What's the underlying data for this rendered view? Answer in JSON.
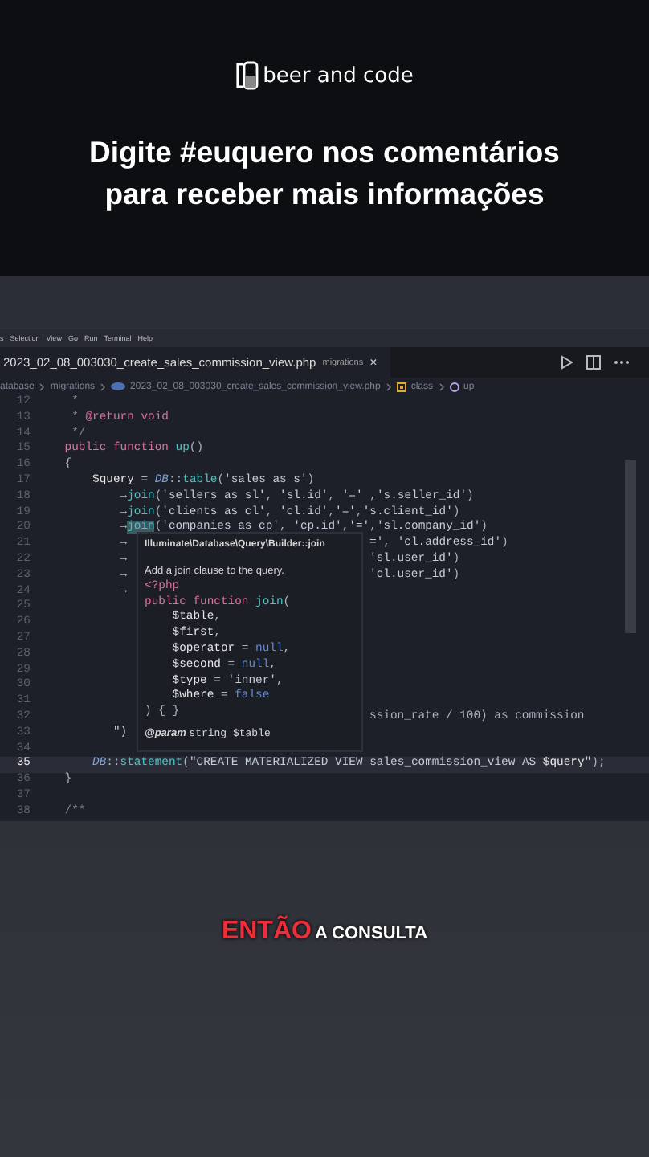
{
  "brand": {
    "name": "beer and code"
  },
  "headline": [
    "Digite #euquero nos comentários",
    "para receber mais informações"
  ],
  "editor": {
    "menu": [
      "s",
      "Selection",
      "View",
      "Go",
      "Run",
      "Terminal",
      "Help"
    ],
    "tab": {
      "file": "2023_02_08_003030_create_sales_commission_view.php",
      "folder": "migrations",
      "close": "×"
    },
    "breadcrumbs": [
      {
        "text": "atabase",
        "kind": "folder"
      },
      {
        "text": "migrations",
        "kind": "folder"
      },
      {
        "text": "2023_02_08_003030_create_sales_commission_view.php",
        "kind": "file"
      },
      {
        "text": "class",
        "kind": "class"
      },
      {
        "text": "up",
        "kind": "method"
      }
    ],
    "lines": [
      {
        "num": "12",
        "current": false,
        "code": [
          {
            "kind": "cm",
            "text": "     *"
          }
        ]
      },
      {
        "num": "13",
        "current": false,
        "code": [
          {
            "kind": "cm",
            "text": "     * "
          },
          {
            "kind": "kw",
            "text": "@return void"
          }
        ]
      },
      {
        "num": "14",
        "current": false,
        "code": [
          {
            "kind": "cm",
            "text": "     */"
          }
        ]
      },
      {
        "num": "15",
        "current": false,
        "code": [
          {
            "kind": "kw",
            "text": "    public function "
          },
          {
            "kind": "fn",
            "text": "up"
          },
          {
            "kind": "p",
            "text": "()"
          }
        ]
      },
      {
        "num": "16",
        "current": false,
        "code": [
          {
            "kind": "p",
            "text": "    {"
          }
        ]
      },
      {
        "num": "17",
        "current": false,
        "code": [
          {
            "kind": "var",
            "text": "        $query"
          },
          {
            "kind": "p",
            "text": " = "
          },
          {
            "kind": "cls",
            "text": "DB"
          },
          {
            "kind": "p",
            "text": "::"
          },
          {
            "kind": "fn",
            "text": "table"
          },
          {
            "kind": "p",
            "text": "("
          },
          {
            "kind": "str",
            "text": "'sales as s'"
          },
          {
            "kind": "p",
            "text": ")"
          }
        ]
      },
      {
        "num": "18",
        "current": false,
        "code": [
          {
            "kind": "p",
            "text": "            →"
          },
          {
            "kind": "fn",
            "text": "join"
          },
          {
            "kind": "p",
            "text": "("
          },
          {
            "kind": "str",
            "text": "'sellers as sl'"
          },
          {
            "kind": "p",
            "text": ", "
          },
          {
            "kind": "str",
            "text": "'sl.id'"
          },
          {
            "kind": "p",
            "text": ", "
          },
          {
            "kind": "str",
            "text": "'='"
          },
          {
            "kind": "p",
            "text": " ,"
          },
          {
            "kind": "str",
            "text": "'s.seller_id'"
          },
          {
            "kind": "p",
            "text": ")"
          }
        ]
      },
      {
        "num": "19",
        "current": false,
        "code": [
          {
            "kind": "p",
            "text": "            →"
          },
          {
            "kind": "fn",
            "text": "join"
          },
          {
            "kind": "p",
            "text": "("
          },
          {
            "kind": "str",
            "text": "'clients as cl'"
          },
          {
            "kind": "p",
            "text": ", "
          },
          {
            "kind": "str",
            "text": "'cl.id'"
          },
          {
            "kind": "p",
            "text": ","
          },
          {
            "kind": "str",
            "text": "'='"
          },
          {
            "kind": "p",
            "text": ","
          },
          {
            "kind": "str",
            "text": "'s.client_id'"
          },
          {
            "kind": "p",
            "text": ")"
          }
        ]
      },
      {
        "num": "20",
        "current": false,
        "code": [
          {
            "kind": "p",
            "text": "            →"
          },
          {
            "kind": "sel",
            "text": "join"
          },
          {
            "kind": "p",
            "text": "("
          },
          {
            "kind": "str",
            "text": "'companies as cp'"
          },
          {
            "kind": "p",
            "text": ", "
          },
          {
            "kind": "str",
            "text": "'cp.id'"
          },
          {
            "kind": "p",
            "text": ","
          },
          {
            "kind": "str",
            "text": "'='"
          },
          {
            "kind": "p",
            "text": ","
          },
          {
            "kind": "str",
            "text": "'sl.company_id'"
          },
          {
            "kind": "p",
            "text": ")"
          }
        ]
      },
      {
        "num": "21",
        "current": false,
        "code": [
          {
            "kind": "p",
            "text": "            →"
          }
        ],
        "after": [
          {
            "kind": "str",
            "text": "='"
          },
          {
            "kind": "p",
            "text": ", "
          },
          {
            "kind": "str",
            "text": "'cl.address_id'"
          },
          {
            "kind": "p",
            "text": ")"
          }
        ]
      },
      {
        "num": "22",
        "current": false,
        "code": [
          {
            "kind": "p",
            "text": "            →"
          }
        ],
        "after": [
          {
            "kind": "str",
            "text": "'sl.user_id'"
          },
          {
            "kind": "p",
            "text": ")"
          }
        ]
      },
      {
        "num": "23",
        "current": false,
        "code": [
          {
            "kind": "p",
            "text": "            →"
          }
        ],
        "after": [
          {
            "kind": "str",
            "text": "'cl.user_id'"
          },
          {
            "kind": "p",
            "text": ")"
          }
        ]
      },
      {
        "num": "24",
        "current": false,
        "code": [
          {
            "kind": "p",
            "text": "            →"
          }
        ]
      },
      {
        "num": "25",
        "current": false
      },
      {
        "num": "26",
        "current": false
      },
      {
        "num": "27",
        "current": false
      },
      {
        "num": "28",
        "current": false
      },
      {
        "num": "29",
        "current": false
      },
      {
        "num": "30",
        "current": false
      },
      {
        "num": "31",
        "current": false
      },
      {
        "num": "32",
        "current": false,
        "after": [
          {
            "kind": "p",
            "text": "ssion_rate / 100) as commission"
          }
        ]
      },
      {
        "num": "33",
        "current": false,
        "code": [
          {
            "kind": "str",
            "text": "           \")"
          }
        ]
      },
      {
        "num": "34",
        "current": false
      },
      {
        "num": "35",
        "current": true,
        "code": [
          {
            "kind": "cls",
            "text": "        DB"
          },
          {
            "kind": "p",
            "text": "::"
          },
          {
            "kind": "fn",
            "text": "statement"
          },
          {
            "kind": "p",
            "text": "("
          },
          {
            "kind": "str",
            "text": "\"CREATE MATERIALIZED VIEW sales_commission_view AS "
          },
          {
            "kind": "var",
            "text": "$query"
          },
          {
            "kind": "str",
            "text": "\""
          },
          {
            "kind": "p",
            "text": ");"
          }
        ]
      },
      {
        "num": "36",
        "current": false,
        "code": [
          {
            "kind": "p",
            "text": "    }"
          }
        ]
      },
      {
        "num": "37",
        "current": false
      },
      {
        "num": "38",
        "current": false,
        "code": [
          {
            "kind": "cm",
            "text": "    /**"
          }
        ]
      }
    ],
    "hover": {
      "title": "Illuminate\\Database\\Query\\Builder::join",
      "description": "Add a join clause to the query.",
      "code": [
        [
          {
            "kind": "kw",
            "text": "<?php"
          }
        ],
        [
          {
            "kind": "kw",
            "text": "public function "
          },
          {
            "kind": "fn",
            "text": "join"
          },
          {
            "kind": "p",
            "text": "("
          }
        ],
        [
          {
            "kind": "var",
            "text": "    $table"
          },
          {
            "kind": "p",
            "text": ","
          }
        ],
        [
          {
            "kind": "var",
            "text": "    $first"
          },
          {
            "kind": "p",
            "text": ","
          }
        ],
        [
          {
            "kind": "var",
            "text": "    $operator"
          },
          {
            "kind": "p",
            "text": " = "
          },
          {
            "kind": "lit",
            "text": "null"
          },
          {
            "kind": "p",
            "text": ","
          }
        ],
        [
          {
            "kind": "var",
            "text": "    $second"
          },
          {
            "kind": "p",
            "text": " = "
          },
          {
            "kind": "lit",
            "text": "null"
          },
          {
            "kind": "p",
            "text": ","
          }
        ],
        [
          {
            "kind": "var",
            "text": "    $type"
          },
          {
            "kind": "p",
            "text": " = "
          },
          {
            "kind": "str",
            "text": "'inner'"
          },
          {
            "kind": "p",
            "text": ","
          }
        ],
        [
          {
            "kind": "var",
            "text": "    $where"
          },
          {
            "kind": "p",
            "text": " = "
          },
          {
            "kind": "lit",
            "text": "false"
          }
        ],
        [
          {
            "kind": "p",
            "text": ") { }"
          }
        ]
      ],
      "param": {
        "tag": "@param",
        "text": "string $table"
      }
    }
  },
  "caption": {
    "highlight": "ENTÃO",
    "rest": "A CONSULTA"
  }
}
